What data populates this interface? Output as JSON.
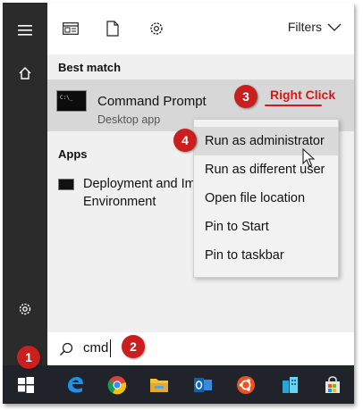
{
  "toolbar": {
    "filters_label": "Filters"
  },
  "best_match": {
    "header": "Best match",
    "title": "Command Prompt",
    "subtitle": "Desktop app",
    "icon_text": "C:\\_"
  },
  "apps": {
    "header": "Apps",
    "item_line1": "Deployment and Im",
    "item_line2": "Environment"
  },
  "context_menu": {
    "items": [
      {
        "label": "Run as administrator"
      },
      {
        "label": "Run as different user"
      },
      {
        "label": "Open file location"
      },
      {
        "label": "Pin to Start"
      },
      {
        "label": "Pin to taskbar"
      }
    ]
  },
  "search": {
    "value": "cmd"
  },
  "annotations": {
    "badge1": "1",
    "badge2": "2",
    "badge3": "3",
    "badge4": "4",
    "right_click": "Right Click"
  },
  "colors": {
    "accent_red": "#c9201f",
    "taskbar": "#20232a",
    "rail": "#2b2b2b"
  }
}
